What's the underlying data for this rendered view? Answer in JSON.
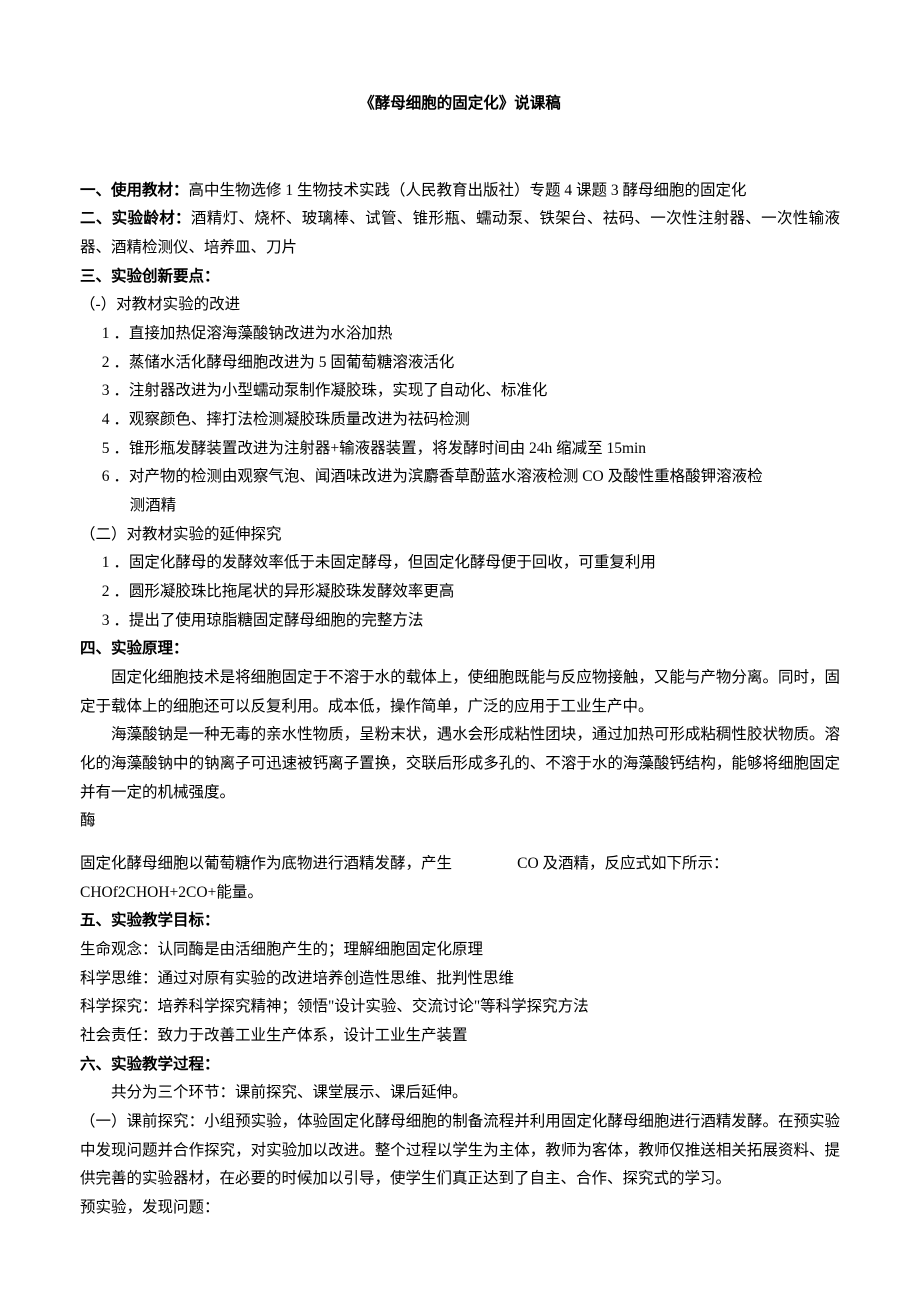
{
  "title": "《酵母细胞的固定化》说课稿",
  "s1": {
    "label": "一、使用教材：",
    "text": "高中生物选修 1 生物技术实践（人民教育出版社）专题 4 课题 3 酵母细胞的固定化"
  },
  "s2": {
    "label": "二、实验龄材：",
    "text": "酒精灯、烧杯、玻璃棒、试管、锥形瓶、蠕动泵、铁架台、祛码、一次性注射器、一次性输液器、酒精检测仪、培养皿、刀片"
  },
  "s3": {
    "label": "三、实验创新要点：",
    "sub1": "（-）对教材实验的改进",
    "items1": [
      "1 ．直接加热促溶海藻酸钠改进为水浴加热",
      "2 ．蒸储水活化酵母细胞改进为 5 固葡萄糖溶液活化",
      "3 ．注射器改进为小型蠕动泵制作凝胶珠，实现了自动化、标准化",
      "4 ．观察颜色、摔打法检测凝胶珠质量改进为祛码检测",
      "5 ．锥形瓶发酵装置改进为注射器+输液器装置，将发酵时间由 24h 缩减至 15min"
    ],
    "item6a": "6 ．对产物的检测由观察气泡、闻酒味改进为滨麝香草酚蓝水溶液检测 CO 及酸性重格酸钾溶液检",
    "item6b": "测酒精",
    "sub2": "（二）对教材实验的延伸探究",
    "items2": [
      "1 ．固定化酵母的发酵效率低于未固定酵母，但固定化酵母便于回收，可重复利用",
      "2 ．圆形凝胶珠比拖尾状的异形凝胶珠发酵效率更高",
      "3 ．提出了使用琼脂糖固定酵母细胞的完整方法"
    ]
  },
  "s4": {
    "label": "四、实验原理：",
    "p1": "固定化细胞技术是将细胞固定于不溶于水的载体上，使细胞既能与反应物接触，又能与产物分离。同时，固定于载体上的细胞还可以反复利用。成本低，操作简单，广泛的应用于工业生产中。",
    "p2": "海藻酸钠是一种无毒的亲水性物质，呈粉末状，遇水会形成粘性团块，通过加热可形成粘稠性胶状物质。溶化的海藻酸钠中的钠离子可迅速被钙离子置换，交联后形成多孔的、不溶于水的海藻酸钙结构，能够将细胞固定并有一定的机械强度。",
    "mei": "酶",
    "p3a": "固定化酵母细胞以葡萄糖作为底物进行酒精发酵，产生",
    "p3b": "CO 及酒精，反应式如下所示：",
    "eq": "CHOf2CHOH+2CO+能量。"
  },
  "s5": {
    "label": "五、实验教学目标：",
    "l1": "生命观念：认同酶是由活细胞产生的；理解细胞固定化原理",
    "l2": "科学思维：通过对原有实验的改进培养创造性思维、批判性思维",
    "l3": "科学探究：培养科学探究精神；领悟\"设计实验、交流讨论\"等科学探究方法",
    "l4": "社会责任：致力于改善工业生产体系，设计工业生产装置"
  },
  "s6": {
    "label": "六、实验教学过程：",
    "p1": "共分为三个环节：课前探究、课堂展示、课后延伸。",
    "p2": "（一）课前探究：小组预实验，体验固定化酵母细胞的制备流程并利用固定化酵母细胞进行酒精发酵。在预实验中发现问题并合作探究，对实验加以改进。整个过程以学生为主体，教师为客体，教师仅推送相关拓展资料、提供完善的实验器材，在必要的时候加以引导，使学生们真正达到了自主、合作、探究式的学习。",
    "p3": "预实验，发现问题："
  }
}
